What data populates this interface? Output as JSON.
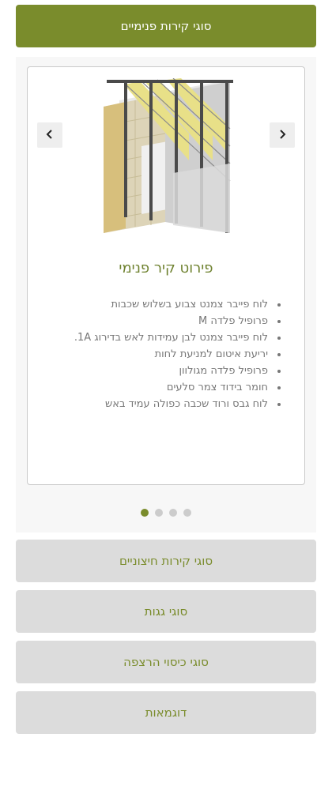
{
  "tabs": [
    {
      "label": "סוגי קירות פנימיים"
    },
    {
      "label": "סוגי קירות חיצוניים"
    },
    {
      "label": "סוגי גגות"
    },
    {
      "label": "סוגי כיסוי הרצפה"
    },
    {
      "label": "דוגמאות"
    }
  ],
  "card": {
    "title": "פירוט קיר פנימי",
    "image": "wall-construction-layers-illustration",
    "items": [
      "לוח פייבר צמנט צבוע בשלוש שכבות",
      "פרופיל פלדה M",
      "לוח פייבר צמנט לבן עמידות לאש בדירוג 1A.",
      "יריעת איטום למניעת לחות",
      "פרופיל פלדה מגולוון",
      "חומר בידוד צמר סלעים",
      "לוח גבס ורוד שכבה כפולה עמיד באש"
    ]
  },
  "carousel": {
    "slides": 4,
    "active_slide": 1,
    "prev_icon": "chevron-left-icon",
    "next_icon": "chevron-right-icon"
  },
  "colors": {
    "accent": "#7a8c2c",
    "inactive_tab": "#dcdcdc",
    "panel": "#f7f7f7",
    "dot": "#cccccc"
  }
}
